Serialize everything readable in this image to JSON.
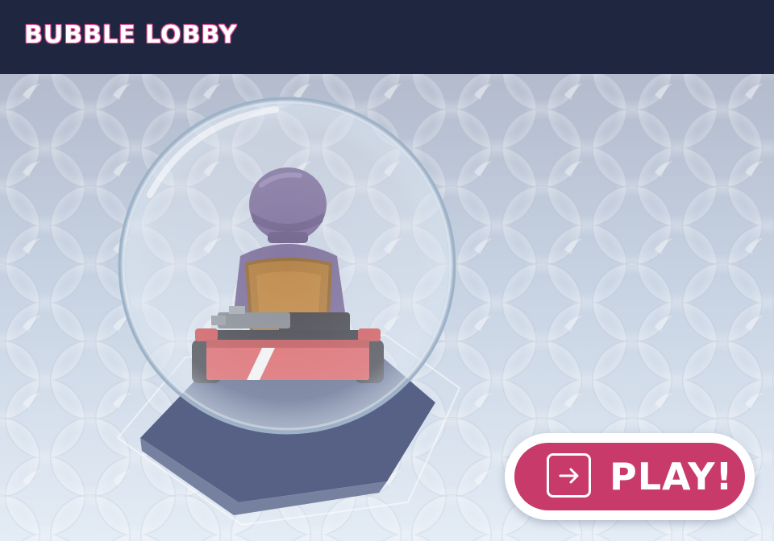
{
  "header": {
    "title": "BUBBLE LOBBY"
  },
  "play_button": {
    "label": "PLAY!",
    "icon": "arrow-right-icon"
  },
  "scene": {
    "player_character": "kart-driver",
    "colors": {
      "header_bg": "#1f2640",
      "play_button": "#c83a6a",
      "kart_body": "#d95a5e",
      "helmet": "#6f5f90",
      "seat": "#a8702c"
    }
  }
}
